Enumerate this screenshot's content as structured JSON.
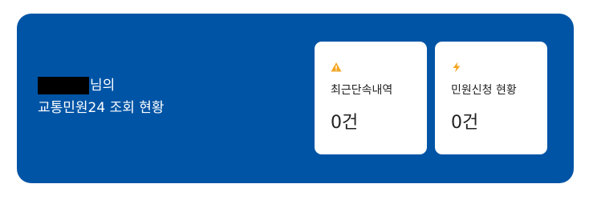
{
  "greeting": {
    "name_redacted": true,
    "line1_suffix": "님의",
    "line2": "교통민원24 조회 현황"
  },
  "cards": [
    {
      "icon": "warning-icon",
      "label": "최근단속내역",
      "value": "0건"
    },
    {
      "icon": "lightning-icon",
      "label": "민원신청 현황",
      "value": "0건"
    }
  ],
  "colors": {
    "banner_bg": "#0054a6",
    "icon_accent": "#f5a623",
    "card_bg": "#ffffff"
  }
}
